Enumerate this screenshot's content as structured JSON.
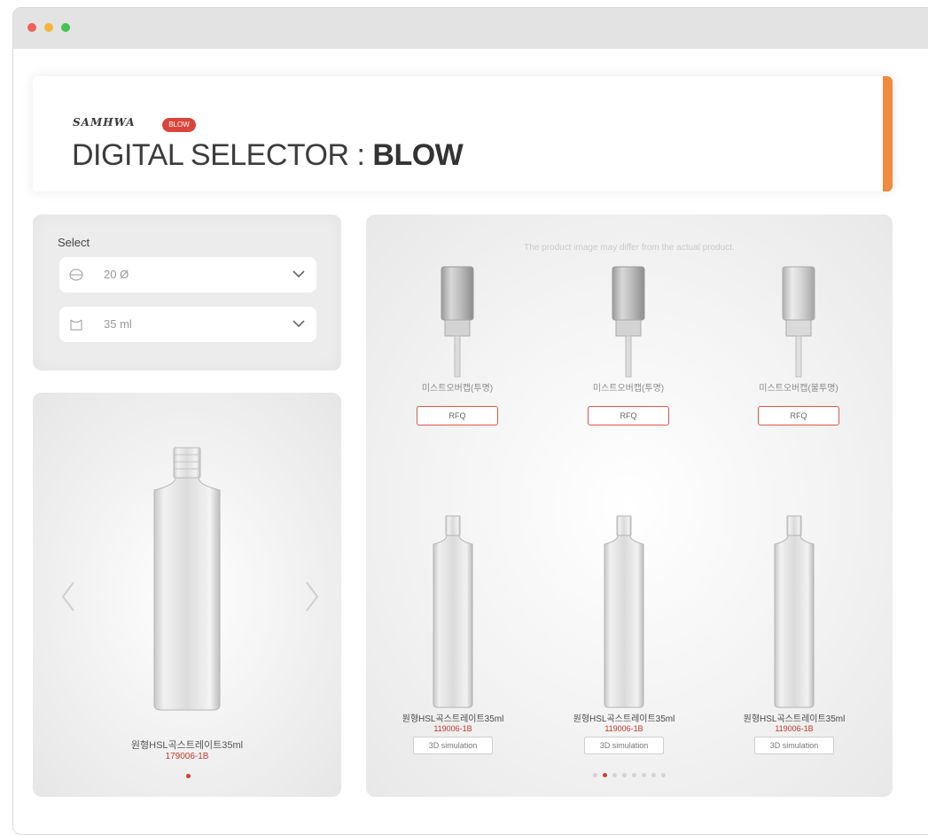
{
  "header": {
    "logo_text": "SAMHWA",
    "logo_badge": "BLOW",
    "title_prefix": "DIGITAL SELECTOR",
    "title_sep": " : ",
    "title_main": "BLOW"
  },
  "selector": {
    "label": "Select",
    "neck_value": "20 Ø",
    "neck_icon": "cap-icon",
    "volume_value": "35 ml",
    "volume_icon": "bottle-icon"
  },
  "preview": {
    "product_name": "원형HSL곡스트레이트35ml",
    "product_code": "179006-1B"
  },
  "catalog": {
    "notice": "The product image may differ from the actual product.",
    "pumps": [
      {
        "name": "미스트오버캡(투명)",
        "button": "RFQ"
      },
      {
        "name": "미스트오버캡(투명)",
        "button": "RFQ"
      },
      {
        "name": "미스트오버캡(불투명)",
        "button": "RFQ"
      }
    ],
    "bottles": [
      {
        "name": "원형HSL곡스트레이트35ml",
        "code": "119006-1B",
        "button": "3D simulation"
      },
      {
        "name": "원형HSL곡스트레이트35ml",
        "code": "119006-1B",
        "button": "3D simulation"
      },
      {
        "name": "원형HSL곡스트레이트35ml",
        "code": "119006-1B",
        "button": "3D simulation"
      }
    ]
  },
  "colors": {
    "accent": "#f08a3c",
    "rfq_border": "#d9574a",
    "code_red": "#c0392b"
  }
}
